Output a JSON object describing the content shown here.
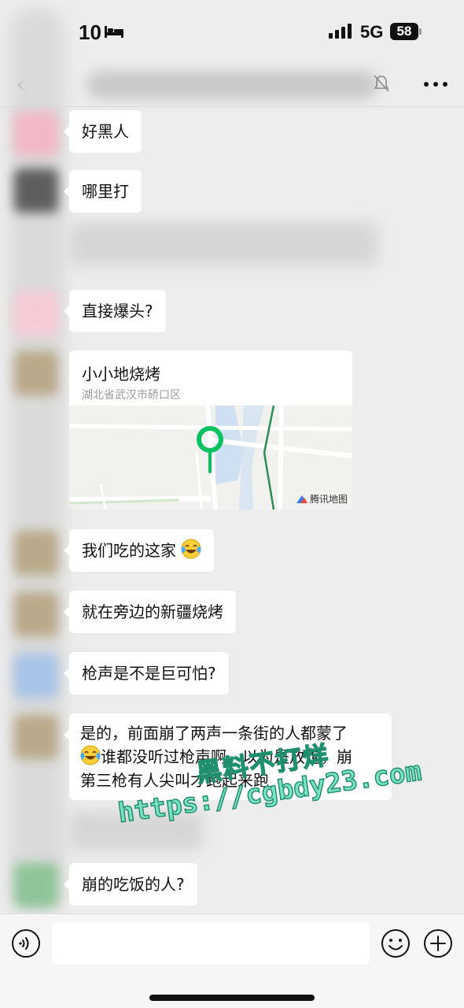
{
  "status_bar": {
    "time": "10",
    "network": "5G",
    "battery": "58",
    "bed_icon": "bed-icon",
    "signal_icon": "signal-icon"
  },
  "nav": {
    "back_icon": "chevron-left-icon",
    "more_icon": "more-dots-icon",
    "mute_icon": "bell-muted-icon"
  },
  "messages": [
    {
      "text": "好黑人"
    },
    {
      "text": "哪里打"
    },
    {
      "text": "直接爆头?"
    },
    {
      "text": "我们吃的这家",
      "emoji": "laugh-cry-emoji"
    },
    {
      "text": "就在旁边的新疆烧烤"
    },
    {
      "text": "枪声是不是巨可怕?"
    },
    {
      "lines": [
        "是的，前面崩了两声一条街的人都蒙了",
        "谁都没听过枪声啊，以为是放炮，崩",
        "第三枪有人尖叫才跑起来跑"
      ],
      "emoji": "laugh-cry-emoji"
    },
    {
      "text": "崩的吃饭的人?"
    }
  ],
  "location": {
    "name": "小小地烧烤",
    "address": "湖北省武汉市硚口区",
    "map_credit": "腾讯地图",
    "pin_color": "#07c160"
  },
  "watermark": {
    "line1": "黑料不打烊",
    "line2": "https://cgbdy23.com"
  },
  "input_bar": {
    "placeholder": "",
    "voice_icon": "voice-icon",
    "emoji_icon": "emoji-smile-icon",
    "plus_icon": "plus-circle-icon"
  }
}
